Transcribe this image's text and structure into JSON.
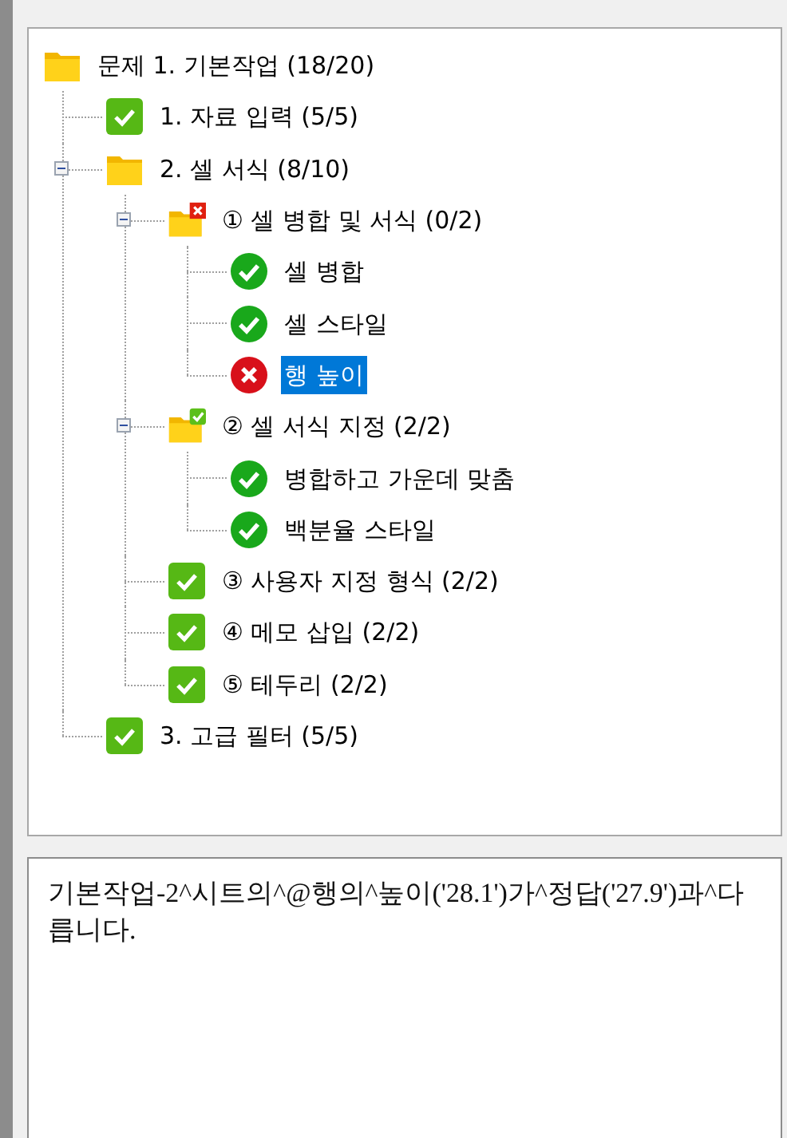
{
  "tree": {
    "label": "문제 1. 기본작업 (18/20)",
    "kind": "folder",
    "selected": false,
    "children": [
      {
        "label": "1. 자료 입력 (5/5)",
        "kind": "check-square",
        "selected": false
      },
      {
        "label": "2. 셀 서식 (8/10)",
        "kind": "folder",
        "selected": false,
        "expanded": true,
        "children": [
          {
            "label": "① 셀 병합 및 서식 (0/2)",
            "kind": "folder-error",
            "selected": false,
            "expanded": true,
            "children": [
              {
                "label": "셀 병합",
                "kind": "check-circle",
                "selected": false
              },
              {
                "label": "셀 스타일",
                "kind": "check-circle",
                "selected": false
              },
              {
                "label": "행 높이",
                "kind": "error-circle",
                "selected": true
              }
            ]
          },
          {
            "label": "② 셀 서식 지정 (2/2)",
            "kind": "folder-ok",
            "selected": false,
            "expanded": true,
            "children": [
              {
                "label": "병합하고 가운데 맞춤",
                "kind": "check-circle",
                "selected": false
              },
              {
                "label": "백분율 스타일",
                "kind": "check-circle",
                "selected": false
              }
            ]
          },
          {
            "label": "③ 사용자 지정 형식 (2/2)",
            "kind": "check-square",
            "selected": false
          },
          {
            "label": "④ 메모 삽입 (2/2)",
            "kind": "check-square",
            "selected": false
          },
          {
            "label": "⑤ 테두리 (2/2)",
            "kind": "check-square",
            "selected": false
          }
        ]
      },
      {
        "label": "3. 고급 필터 (5/5)",
        "kind": "check-square",
        "selected": false
      }
    ]
  },
  "message": "기본작업-2^시트의^@행의^높이('28.1')가^정답('27.9')과^다릅니다."
}
